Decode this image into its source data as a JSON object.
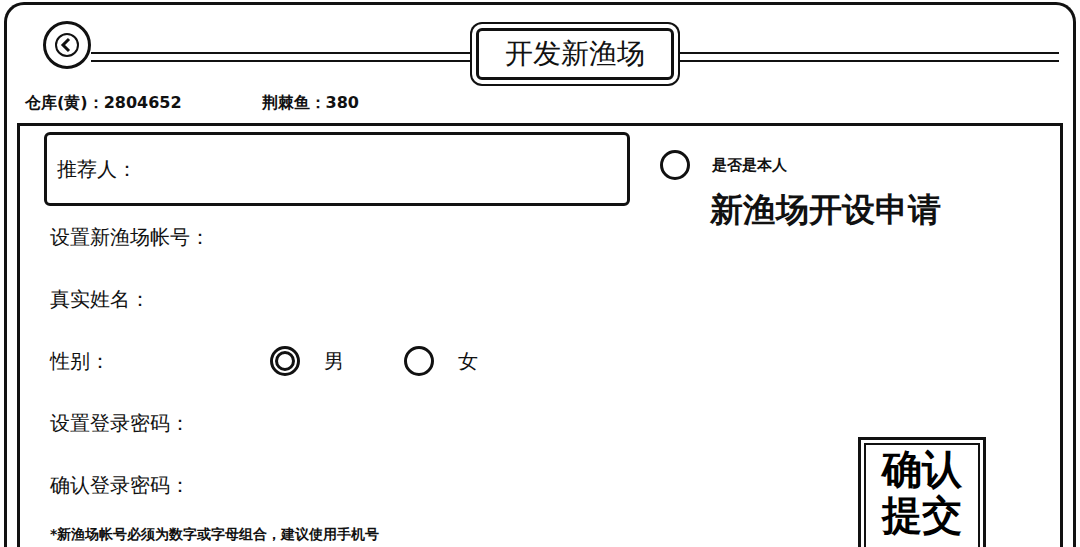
{
  "window": {
    "title": "开发新渔场"
  },
  "stats": [
    {
      "label": "仓库(黄)：",
      "value": "2804652"
    },
    {
      "label": "荆棘鱼：",
      "value": "380"
    }
  ],
  "form": {
    "referrer": {
      "label": "推荐人：",
      "value": ""
    },
    "self_option": {
      "label": "是否是本人",
      "selected": false
    },
    "heading": "新渔场开设申请",
    "fields": [
      {
        "label": "设置新渔场帐号：",
        "kind": "input",
        "options": []
      },
      {
        "label": "真实姓名：",
        "kind": "input",
        "options": []
      },
      {
        "label": "性别：",
        "kind": "radio",
        "options": [
          {
            "label": "男",
            "selected": true
          },
          {
            "label": "女",
            "selected": false
          }
        ]
      },
      {
        "label": "设置登录密码：",
        "kind": "input",
        "options": []
      },
      {
        "label": "确认登录密码：",
        "kind": "input",
        "options": []
      }
    ],
    "note": "*新渔场帐号必须为数字或字母组合，建议使用手机号",
    "submit": "确认提交"
  }
}
